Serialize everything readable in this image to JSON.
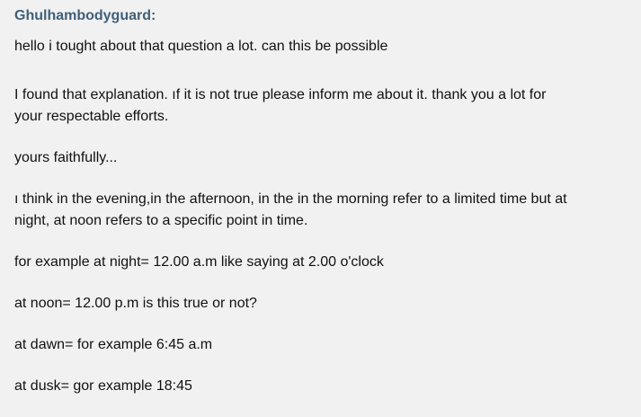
{
  "post": {
    "author": "Ghulhambodyguard:",
    "paragraphs": [
      "hello i tought about that question a lot. can this be possible",
      "I found that explanation. ıf it is not true please inform me about it. thank you a lot for\nyour respectable efforts.",
      "yours faithfully...",
      "ı think in the evening,in the afternoon, in the in the morning refer to a limited time but at\nnight, at noon refers to a specific point in time.",
      "for example at night= 12.00 a.m like saying at 2.00 o'clock",
      "at noon= 12.00 p.m is this true or not?",
      "at dawn= for example 6:45 a.m",
      "at dusk= gor example 18:45"
    ]
  }
}
